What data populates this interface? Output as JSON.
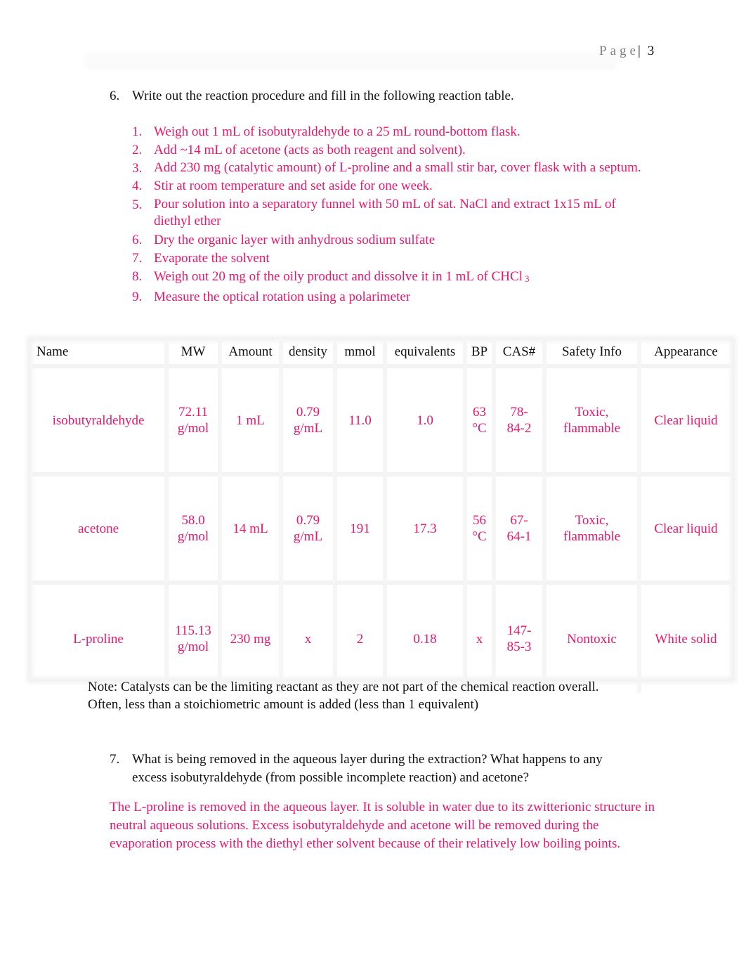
{
  "header": {
    "page_label": "Page",
    "page_number": "3"
  },
  "question6": {
    "number": "6.",
    "text": "Write out the reaction procedure and fill in the following reaction table.",
    "steps": [
      {
        "n": "1.",
        "text": "Weigh out 1 mL of isobutyraldehyde to a 25 mL round-bottom flask."
      },
      {
        "n": "2.",
        "text": "Add ~14 mL of acetone (acts as both reagent and solvent)."
      },
      {
        "n": "3.",
        "text": "Add 230 mg (catalytic amount) of L-proline and a small stir bar, cover flask with a septum."
      },
      {
        "n": "4.",
        "text": "Stir at room temperature and set aside for one week."
      },
      {
        "n": "5.",
        "text": "Pour solution into a separatory funnel with 50 mL of sat. NaCl and extract 1x15 mL of diethyl ether"
      },
      {
        "n": "6.",
        "text": "Dry the organic layer with anhydrous sodium sulfate"
      },
      {
        "n": "7.",
        "text": "Evaporate the solvent"
      },
      {
        "n": "8.",
        "text": "Weigh out 20 mg of the oily product and dissolve it in 1 mL of CHCl",
        "sub": "3"
      },
      {
        "n": "9.",
        "text": "Measure the optical rotation using a polarimeter"
      }
    ]
  },
  "table": {
    "headers": [
      "Name",
      "MW",
      "Amount",
      "density",
      "mmol",
      "equivalents",
      "BP",
      "CAS#",
      "Safety Info",
      "Appearance"
    ],
    "rows": [
      {
        "name": "isobutyraldehyde",
        "mw_1": "72.11",
        "mw_2": "g/mol",
        "amount": "1 mL",
        "density_1": "0.79",
        "density_2": "g/mL",
        "mmol": "11.0",
        "equivalents": "1.0",
        "bp_1": "63",
        "bp_2": "°C",
        "cas_1": "78-",
        "cas_2": "84-2",
        "safety_1": "Toxic,",
        "safety_2": "flammable",
        "appearance": "Clear liquid"
      },
      {
        "name": "acetone",
        "mw_1": "58.0",
        "mw_2": "g/mol",
        "amount": "14 mL",
        "density_1": "0.79",
        "density_2": "g/mL",
        "mmol": "191",
        "equivalents": "17.3",
        "bp_1": "56",
        "bp_2": "°C",
        "cas_1": "67-",
        "cas_2": "64-1",
        "safety_1": "Toxic,",
        "safety_2": "flammable",
        "appearance": "Clear liquid"
      },
      {
        "name": "L-proline",
        "mw_1": "115.13",
        "mw_2": "g/mol",
        "amount": "230 mg",
        "density_1": "x",
        "density_2": "",
        "mmol": "2",
        "equivalents": "0.18",
        "bp_1": "x",
        "bp_2": "",
        "cas_1": "147-",
        "cas_2": "85-3",
        "safety_1": "Nontoxic",
        "safety_2": "",
        "appearance": "White solid"
      }
    ]
  },
  "note": {
    "line1": "Note: Catalysts can be the limiting reactant as they are not part of the chemical reaction overall.",
    "line2": "Often, less than a stoichiometric amount is added (less than 1 equivalent)"
  },
  "question7": {
    "number": "7.",
    "line1": "What is being removed in the aqueous layer during the extraction?  What happens to any",
    "line2": "excess isobutyraldehyde (from possible incomplete reaction) and acetone?",
    "answer": "The L-proline is removed in the aqueous layer.  It is soluble in water due to its zwitterionic structure in neutral aqueous solutions.   Excess isobutyraldehyde and acetone will be removed during the evaporation process with the diethyl ether solvent because of their relatively low boiling points."
  },
  "colors": {
    "answer_text": "#e8176b",
    "body_text": "#111111",
    "page_label": "#808080"
  }
}
